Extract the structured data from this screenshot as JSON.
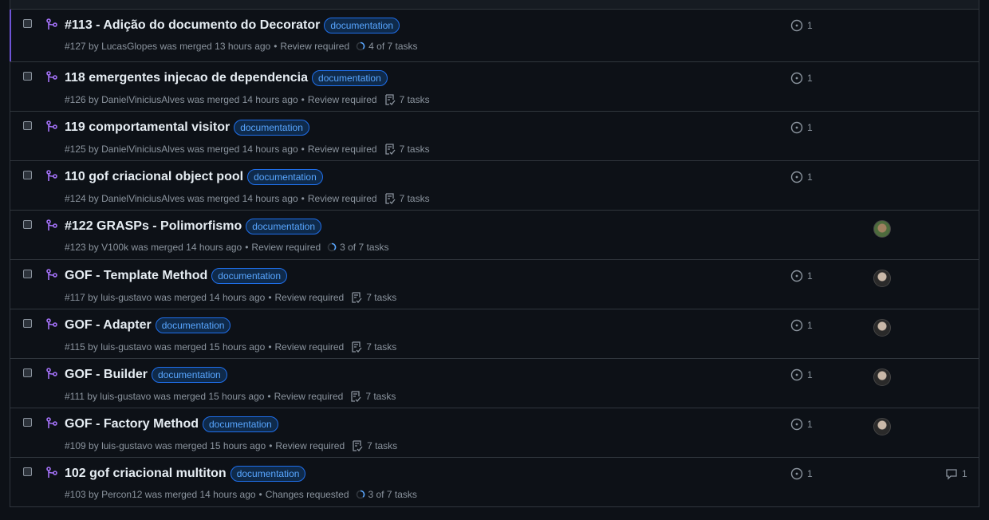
{
  "colors": {
    "accent_purple": "#a371f7",
    "label_blue": "#58a6ff",
    "selected_bar": "#6e54d6"
  },
  "pull_requests": [
    {
      "title": "#113 - Adição do documento do Decorator",
      "label": "documentation",
      "number": "#127",
      "by": "by",
      "author": "LucasGlopes",
      "merged_text": "was merged 13 hours ago",
      "bullet": "•",
      "review": "Review required",
      "tasks": "4 of 7 tasks",
      "task_style": "progress",
      "issue_count": "1",
      "avatar": "",
      "comment_count": ""
    },
    {
      "title": "118 emergentes injecao de dependencia",
      "label": "documentation",
      "number": "#126",
      "by": "by",
      "author": "DanielViniciusAlves",
      "merged_text": "was merged 14 hours ago",
      "bullet": "•",
      "review": "Review required",
      "tasks": "7 tasks",
      "task_style": "checklist",
      "issue_count": "1",
      "avatar": "",
      "comment_count": ""
    },
    {
      "title": "119 comportamental visitor",
      "label": "documentation",
      "number": "#125",
      "by": "by",
      "author": "DanielViniciusAlves",
      "merged_text": "was merged 14 hours ago",
      "bullet": "•",
      "review": "Review required",
      "tasks": "7 tasks",
      "task_style": "checklist",
      "issue_count": "1",
      "avatar": "",
      "comment_count": ""
    },
    {
      "title": "110 gof criacional object pool",
      "label": "documentation",
      "number": "#124",
      "by": "by",
      "author": "DanielViniciusAlves",
      "merged_text": "was merged 14 hours ago",
      "bullet": "•",
      "review": "Review required",
      "tasks": "7 tasks",
      "task_style": "checklist",
      "issue_count": "1",
      "avatar": "",
      "comment_count": ""
    },
    {
      "title": "#122 GRASPs - Polimorfismo",
      "label": "documentation",
      "number": "#123",
      "by": "by",
      "author": "V100k",
      "merged_text": "was merged 14 hours ago",
      "bullet": "•",
      "review": "Review required",
      "tasks": "3 of 7 tasks",
      "task_style": "progress",
      "issue_count": "",
      "avatar": "green",
      "comment_count": ""
    },
    {
      "title": "GOF - Template Method",
      "label": "documentation",
      "number": "#117",
      "by": "by",
      "author": "luis-gustavo",
      "merged_text": "was merged 14 hours ago",
      "bullet": "•",
      "review": "Review required",
      "tasks": "7 tasks",
      "task_style": "checklist",
      "issue_count": "1",
      "avatar": "dark",
      "comment_count": ""
    },
    {
      "title": "GOF - Adapter",
      "label": "documentation",
      "number": "#115",
      "by": "by",
      "author": "luis-gustavo",
      "merged_text": "was merged 15 hours ago",
      "bullet": "•",
      "review": "Review required",
      "tasks": "7 tasks",
      "task_style": "checklist",
      "issue_count": "1",
      "avatar": "dark",
      "comment_count": ""
    },
    {
      "title": "GOF - Builder",
      "label": "documentation",
      "number": "#111",
      "by": "by",
      "author": "luis-gustavo",
      "merged_text": "was merged 15 hours ago",
      "bullet": "•",
      "review": "Review required",
      "tasks": "7 tasks",
      "task_style": "checklist",
      "issue_count": "1",
      "avatar": "dark",
      "comment_count": ""
    },
    {
      "title": "GOF - Factory Method",
      "label": "documentation",
      "number": "#109",
      "by": "by",
      "author": "luis-gustavo",
      "merged_text": "was merged 15 hours ago",
      "bullet": "•",
      "review": "Review required",
      "tasks": "7 tasks",
      "task_style": "checklist",
      "issue_count": "1",
      "avatar": "dark",
      "comment_count": ""
    },
    {
      "title": "102 gof criacional multiton",
      "label": "documentation",
      "number": "#103",
      "by": "by",
      "author": "Percon12",
      "merged_text": "was merged 14 hours ago",
      "bullet": "•",
      "review": "Changes requested",
      "tasks": "3 of 7 tasks",
      "task_style": "progress",
      "issue_count": "1",
      "avatar": "",
      "comment_count": "1"
    }
  ]
}
